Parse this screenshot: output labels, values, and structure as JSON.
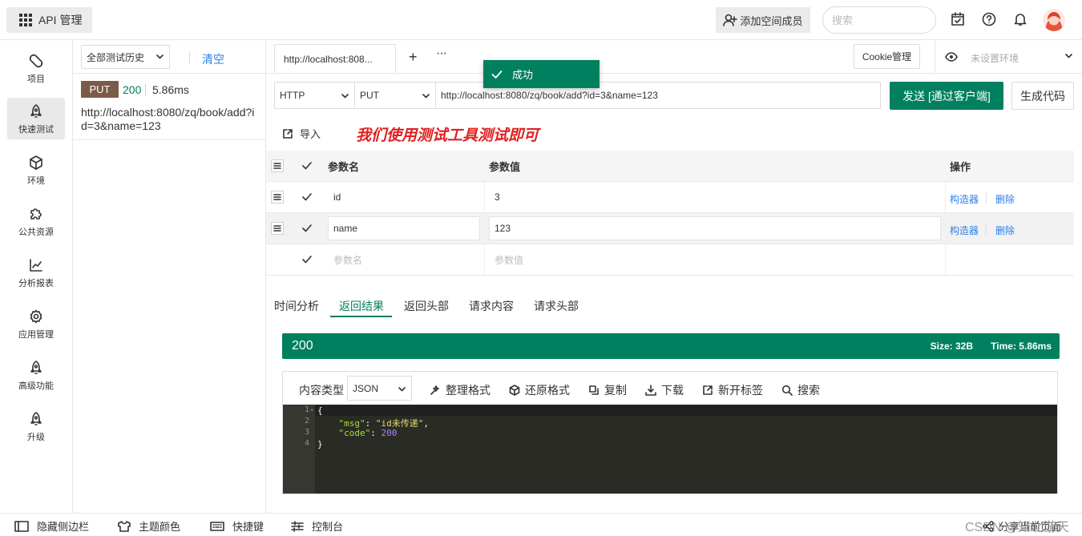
{
  "topbar": {
    "app_title": "API 管理",
    "invite_label": "添加空间成员",
    "search_placeholder": "搜索",
    "icons": [
      "grid-icon",
      "user-plus-icon",
      "calendar-check-icon",
      "help-icon",
      "bell-icon",
      "avatar"
    ]
  },
  "nav": {
    "items": [
      {
        "label": "项目",
        "icon": "project-icon"
      },
      {
        "label": "快速测试",
        "icon": "rocket-icon",
        "active": true
      },
      {
        "label": "环境",
        "icon": "cube-icon"
      },
      {
        "label": "公共资源",
        "icon": "puzzle-icon"
      },
      {
        "label": "分析报表",
        "icon": "chart-icon"
      },
      {
        "label": "应用管理",
        "icon": "gear-icon"
      },
      {
        "label": "高级功能",
        "icon": "rocket-icon"
      },
      {
        "label": "升级",
        "icon": "rocket-icon"
      }
    ]
  },
  "history": {
    "filter": "全部测试历史",
    "clear_label": "清空",
    "item": {
      "method": "PUT",
      "status": "200",
      "time": "5.86ms",
      "url": "http://localhost:8080/zq/book/add?id=3&name=123"
    }
  },
  "tabs": {
    "active_tab": "http://localhost:808...",
    "add": "+",
    "more": "···",
    "cookie_label": "Cookie管理",
    "env_label": "未设置环境"
  },
  "request": {
    "protocol": "HTTP",
    "method": "PUT",
    "url": "http://localhost:8080/zq/book/add?id=3&name=123",
    "send_label": "发送 [通过客户端]",
    "gencode_label": "生成代码",
    "import_label": "导入",
    "annotation": "我们使用测试工具测试即可"
  },
  "params": {
    "headers": {
      "name": "参数名",
      "value": "参数值",
      "ops": "操作"
    },
    "rows": [
      {
        "name": "id",
        "value": "3",
        "builder": "构造器",
        "delete": "删除"
      },
      {
        "name": "name",
        "value": "123",
        "builder": "构造器",
        "delete": "删除"
      }
    ],
    "placeholder_name": "参数名",
    "placeholder_value": "参数值"
  },
  "response": {
    "tabs": [
      "时间分析",
      "返回结果",
      "返回头部",
      "请求内容",
      "请求头部"
    ],
    "active_tab": "返回结果",
    "status_code": "200",
    "size": "Size:  32B",
    "time": "Time:  5.86ms",
    "content_type_label": "内容类型",
    "content_type": "JSON",
    "tools": [
      "整理格式",
      "还原格式",
      "复制",
      "下载",
      "新开标签",
      "搜索"
    ],
    "code_lines": [
      "1",
      "2",
      "3",
      "4"
    ],
    "json": {
      "open": "{",
      "msg_key": "\"msg\"",
      "msg_val": "\"id未传递\"",
      "code_key": "\"code\"",
      "code_val": "200",
      "close": "}"
    }
  },
  "toast": {
    "message": "成功"
  },
  "bottombar": {
    "items": [
      "隐藏侧边栏",
      "主题颜色",
      "快捷键",
      "控制台"
    ],
    "share": "分享当前页面",
    "watermark": "CSDN @知北游天"
  },
  "colors": {
    "brand": "#00805e",
    "link": "#2b7de9",
    "put": "#7b5a48",
    "annotation": "#e02020"
  }
}
